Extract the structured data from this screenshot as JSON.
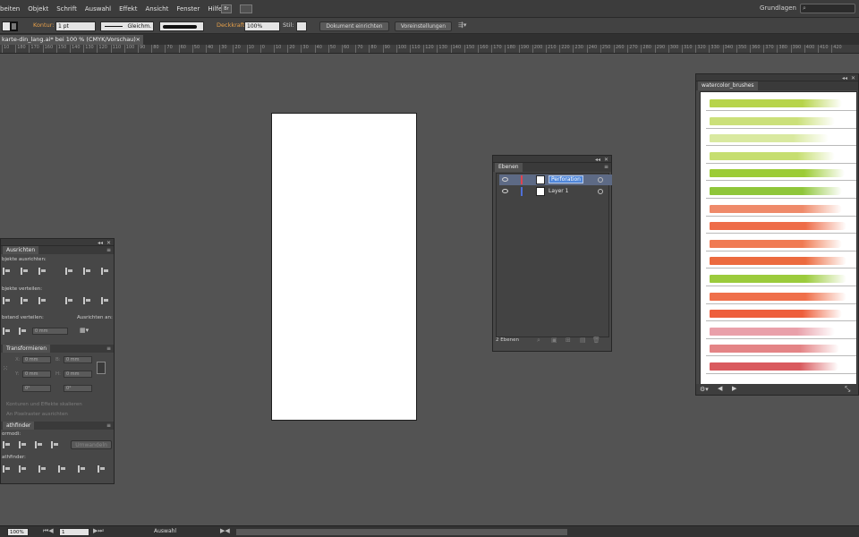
{
  "menubar": {
    "items": [
      "beiten",
      "Objekt",
      "Schrift",
      "Auswahl",
      "Effekt",
      "Ansicht",
      "Fenster",
      "Hilfe"
    ],
    "app_icon": "Br",
    "workspace": "Grundlagen"
  },
  "control_bar": {
    "stroke_label": "Kontur:",
    "stroke_weight": "1 pt",
    "stroke_profile": "Gleichm.",
    "opacity_label": "Deckkraft:",
    "opacity_value": "100%",
    "style_label": "Stil:",
    "document_setup_button": "Dokument einrichten",
    "preferences_button": "Voreinstellungen"
  },
  "document_tab": {
    "title": "karte-din_lang.ai* bei 100 % (CMYK/Vorschau)",
    "close": "×"
  },
  "ruler": {
    "ticks": [
      "10",
      "180",
      "170",
      "160",
      "150",
      "140",
      "130",
      "120",
      "110",
      "100",
      "90",
      "80",
      "70",
      "60",
      "50",
      "40",
      "30",
      "20",
      "10",
      "0",
      "10",
      "20",
      "30",
      "40",
      "50",
      "60",
      "70",
      "80",
      "90",
      "100",
      "110",
      "120",
      "130",
      "140",
      "150",
      "160",
      "170",
      "180",
      "190",
      "200",
      "210",
      "220",
      "230",
      "240",
      "250",
      "260",
      "270",
      "280",
      "290",
      "300",
      "310",
      "320",
      "330",
      "340",
      "350",
      "360",
      "370",
      "380",
      "390",
      "400",
      "410",
      "420"
    ]
  },
  "align_panel": {
    "tab": "Ausrichten",
    "align_objects_label": "bjekte ausrichten:",
    "distribute_objects_label": "bjekte verteilen:",
    "distribute_spacing_label": "bstand verteilen:",
    "align_to_label": "Ausrichten an:",
    "spacing_value": "0 mm"
  },
  "transform_panel": {
    "tab": "Transformieren",
    "x_label": "X:",
    "x_value": "0 mm",
    "y_label": "Y:",
    "y_value": "0 mm",
    "w_label": "B:",
    "w_value": "0 mm",
    "h_label": "H:",
    "h_value": "0 mm",
    "rotate_value": "0°",
    "shear_value": "0°",
    "scale_strokes_label": "Konturen und Effekte skalieren",
    "pixel_align_label": "An Pixelraster ausrichten"
  },
  "pathfinder_panel": {
    "tab": "athfinder",
    "shape_modes_label": "ormodi:",
    "pathfinders_label": "athfinder:",
    "expand_button": "Umwandeln"
  },
  "layers_panel": {
    "tab": "Ebenen",
    "layers": [
      {
        "name": "Perforation",
        "color": "#e0434f",
        "selected": true
      },
      {
        "name": "Layer 1",
        "color": "#4f6fd8",
        "selected": false
      }
    ],
    "footer": "2 Ebenen"
  },
  "brushes_panel": {
    "tab": "watercolor_brushes",
    "strokes": [
      {
        "color": "#b7d44a",
        "level": 0.95
      },
      {
        "color": "#cbe07a",
        "level": 0.9
      },
      {
        "color": "#d9e9a0",
        "level": 0.85
      },
      {
        "color": "#c6de70",
        "level": 0.9
      },
      {
        "color": "#9ccc35",
        "level": 0.97
      },
      {
        "color": "#8fc63a",
        "level": 0.95
      },
      {
        "color": "#ef8a6a",
        "level": 0.95
      },
      {
        "color": "#ee6c48",
        "level": 0.98
      },
      {
        "color": "#f07a52",
        "level": 0.95
      },
      {
        "color": "#ec6a3e",
        "level": 0.98
      },
      {
        "color": "#9bcb3c",
        "level": 0.98
      },
      {
        "color": "#ef6f4a",
        "level": 0.98
      },
      {
        "color": "#ee5f3c",
        "level": 0.95
      },
      {
        "color": "#e9a0aa",
        "level": 0.9
      },
      {
        "color": "#e48486",
        "level": 0.93
      },
      {
        "color": "#d95a5e",
        "level": 0.92
      }
    ]
  },
  "status_bar": {
    "zoom": "100%",
    "artboard": "1",
    "tool": "Auswahl"
  }
}
